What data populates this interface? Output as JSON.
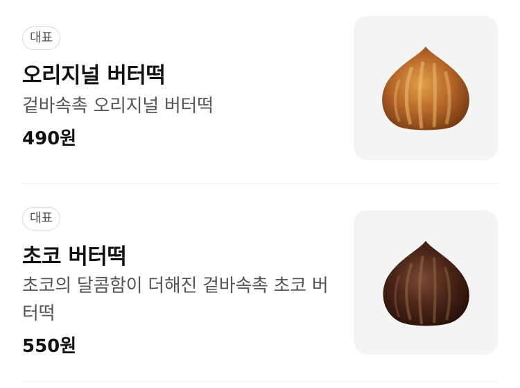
{
  "menu": {
    "items": [
      {
        "badge": "대표",
        "name": "오리지널 버터떡",
        "description": "겉바속촉 오리지널 버터떡",
        "price": "490원",
        "image_icon": "butter-rice-cake-original-image",
        "color": "#b86a2a"
      },
      {
        "badge": "대표",
        "name": "초코 버터떡",
        "description": "초코의 달콤함이 더해진 겉바속촉 초코 버터떡",
        "price": "550원",
        "image_icon": "butter-rice-cake-choco-image",
        "color": "#4a2518"
      }
    ]
  }
}
